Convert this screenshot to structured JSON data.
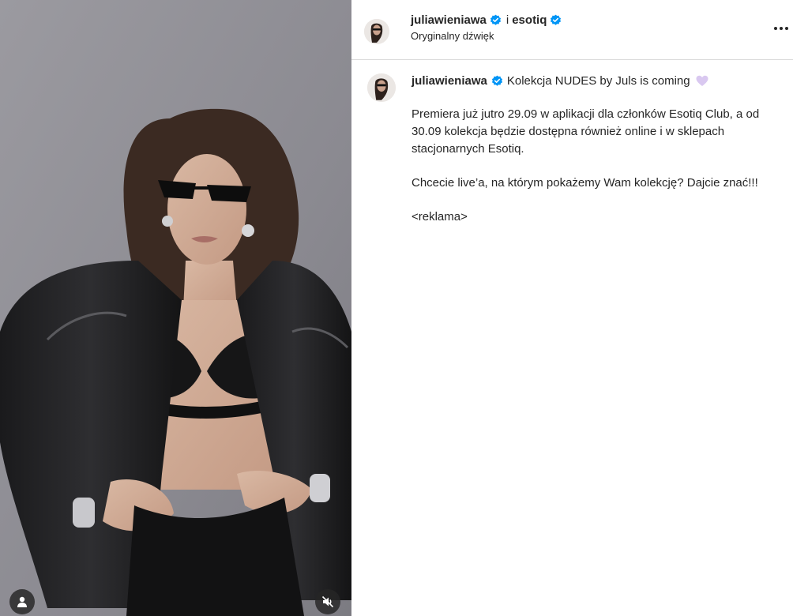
{
  "header": {
    "author": "juliawieniawa",
    "joiner": "i",
    "coauthor": "esotiq",
    "audio_label": "Oryginalny dźwięk"
  },
  "caption": {
    "author": "juliawieniawa",
    "title": "Kolekcja NUDES by Juls is coming",
    "paragraphs": [
      "Premiera już jutro 29.09 w aplikacji dla członków Esotiq Club, a od 30.09 kolekcja będzie dostępna również online i w sklepach stacjonarnych Esotiq.",
      "Chcecie live’a, na którym pokażemy Wam kolekcję? Dajcie znać!!!",
      "<reklama>"
    ]
  },
  "icons": {
    "verified": "verified-badge-icon",
    "heart": "light-purple-heart-icon",
    "tag": "user-tag-icon",
    "mute": "speaker-muted-icon",
    "more": "more-options-icon"
  },
  "colors": {
    "verified": "#0095f6",
    "heart": "#d9c8f0",
    "divider": "#dbdbdb",
    "text": "#262626",
    "media_background": "#8e8e96"
  }
}
